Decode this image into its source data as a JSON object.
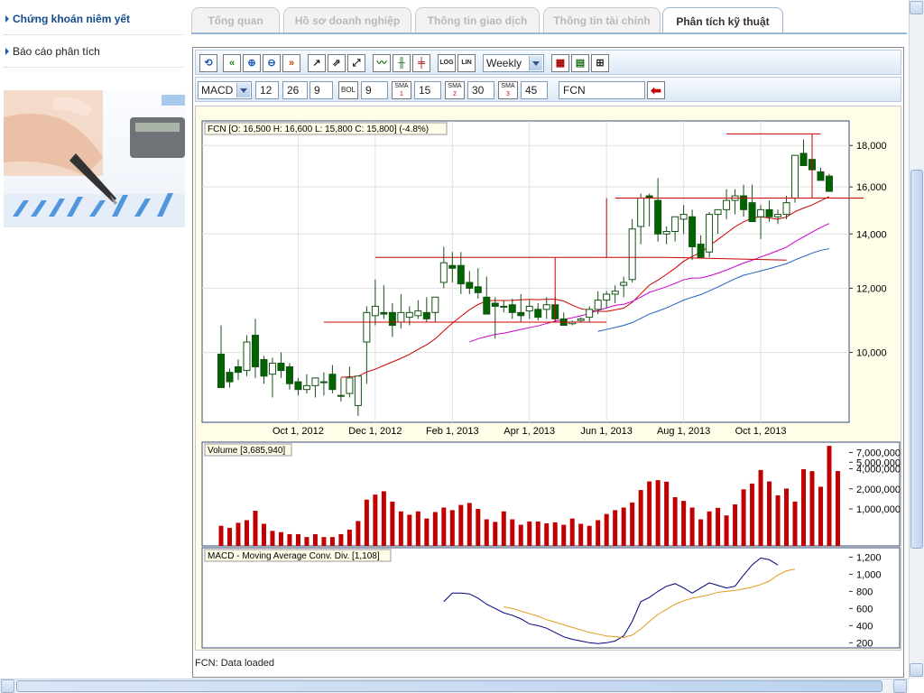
{
  "sidebar": {
    "items": [
      {
        "label": "Chứng khoán niêm yết"
      },
      {
        "label": "Báo cáo phân tích"
      }
    ]
  },
  "tabs": [
    {
      "label": "Tổng quan"
    },
    {
      "label": "Hồ sơ doanh nghiệp"
    },
    {
      "label": "Thông tin giao dịch"
    },
    {
      "label": "Thông tin tài chính"
    },
    {
      "label": "Phân tích kỹ thuật"
    }
  ],
  "toolbar": {
    "scale_log": "LOG",
    "scale_lin": "LIN",
    "period": "Weekly",
    "indicator": "MACD",
    "macd_fast": "12",
    "macd_slow": "26",
    "macd_signal": "9",
    "bol_label": "BOL",
    "bol_value": "9",
    "sma1_label": "SMA",
    "sma1_num": "1",
    "sma1_value": "15",
    "sma2_label": "SMA",
    "sma2_num": "2",
    "sma2_value": "30",
    "sma3_label": "SMA",
    "sma3_num": "3",
    "sma3_value": "45",
    "symbol": "FCN"
  },
  "status": "FCN: Data loaded",
  "colors": {
    "up": "#ffffff",
    "down": "#006400",
    "volume": "#c00000",
    "sma1": "#cc0000",
    "sma2": "#cc00cc",
    "sma3": "#1f5fc4",
    "macd": "#000080",
    "signal": "#e09a1a",
    "trend": "#cc0000"
  },
  "chart_data": [
    {
      "type": "candlestick",
      "title": "FCN [O: 16,500  H: 16,600  L: 15,800  C: 15,800] (-4.8%)",
      "x_tick_labels": [
        "Oct 1, 2012",
        "Dec 1, 2012",
        "Feb 1, 2013",
        "Apr 1, 2013",
        "Jun 1, 2013",
        "Aug 1, 2013",
        "Oct 1, 2013"
      ],
      "y_tick_labels": [
        "10,000",
        "12,000",
        "14,000",
        "16,000",
        "18,000"
      ],
      "scale": "log",
      "ylim": [
        8200,
        19300
      ],
      "ohlc": [
        [
          9950,
          10800,
          9100,
          9050
        ],
        [
          9450,
          9550,
          9050,
          9200
        ],
        [
          9600,
          9800,
          9250,
          9450
        ],
        [
          9500,
          10500,
          9350,
          10300
        ],
        [
          10500,
          11000,
          9300,
          9600
        ],
        [
          9800,
          9900,
          9150,
          9350
        ],
        [
          9400,
          9850,
          8800,
          9700
        ],
        [
          9700,
          10000,
          9300,
          9500
        ],
        [
          9600,
          9700,
          9000,
          9150
        ],
        [
          9200,
          9300,
          8850,
          9000
        ],
        [
          9000,
          9400,
          8900,
          9100
        ],
        [
          9100,
          9250,
          8800,
          9300
        ],
        [
          9200,
          9450,
          8850,
          9200
        ],
        [
          9400,
          9650,
          8900,
          9000
        ],
        [
          8850,
          9300,
          8700,
          8850
        ],
        [
          8900,
          9600,
          8800,
          9300
        ],
        [
          8600,
          9300,
          8350,
          9350
        ],
        [
          10300,
          11400,
          9150,
          11200
        ],
        [
          11100,
          12300,
          10800,
          11400
        ],
        [
          11200,
          12100,
          11000,
          11150
        ],
        [
          11200,
          11500,
          10450,
          10800
        ],
        [
          10900,
          11800,
          10700,
          11200
        ],
        [
          11050,
          11400,
          10800,
          11200
        ],
        [
          11100,
          11600,
          11000,
          11250
        ],
        [
          11200,
          11700,
          10900,
          11000
        ],
        [
          11200,
          11600,
          10900,
          11700
        ],
        [
          12200,
          13500,
          12000,
          12900
        ],
        [
          12800,
          13300,
          12200,
          12700
        ],
        [
          12800,
          13300,
          11800,
          12150
        ],
        [
          12200,
          12600,
          11800,
          12000
        ],
        [
          12050,
          12700,
          11650,
          11850
        ],
        [
          11700,
          12400,
          11300,
          11150
        ],
        [
          11500,
          11700,
          10400,
          11400
        ],
        [
          11400,
          11600,
          11200,
          11400
        ],
        [
          11450,
          11650,
          11000,
          11200
        ],
        [
          11200,
          11800,
          10900,
          11100
        ],
        [
          11250,
          11600,
          11000,
          11400
        ],
        [
          11300,
          11500,
          10950,
          11050
        ],
        [
          11300,
          11700,
          11000,
          11450
        ],
        [
          11450,
          11700,
          10900,
          11000
        ],
        [
          11000,
          11200,
          10900,
          10800
        ],
        [
          10850,
          10950,
          10800,
          10900
        ],
        [
          10950,
          11050,
          10900,
          11000
        ],
        [
          11050,
          11400,
          10900,
          11300
        ],
        [
          11300,
          11900,
          11150,
          11600
        ],
        [
          11600,
          11900,
          11350,
          11800
        ],
        [
          11800,
          12100,
          11500,
          11900
        ],
        [
          12100,
          12400,
          11700,
          12200
        ],
        [
          12300,
          14600,
          12200,
          14200
        ],
        [
          14300,
          15700,
          13600,
          15500
        ],
        [
          15600,
          15700,
          14300,
          15500
        ],
        [
          15400,
          16400,
          13700,
          14000
        ],
        [
          14000,
          14300,
          13600,
          14100
        ],
        [
          14100,
          14500,
          13700,
          14700
        ],
        [
          14600,
          15200,
          14000,
          14800
        ],
        [
          14700,
          15000,
          13000,
          13500
        ],
        [
          13600,
          13950,
          13200,
          13100
        ],
        [
          13300,
          14900,
          13100,
          14800
        ],
        [
          14800,
          15000,
          14000,
          15000
        ],
        [
          15000,
          15900,
          14600,
          15400
        ],
        [
          15400,
          15900,
          14800,
          15600
        ],
        [
          15600,
          16100,
          14700,
          15000
        ],
        [
          15300,
          16100,
          14800,
          14500
        ],
        [
          14700,
          15200,
          13800,
          15000
        ],
        [
          15000,
          15400,
          14500,
          14700
        ],
        [
          14700,
          15000,
          14400,
          14800
        ],
        [
          14800,
          15600,
          14600,
          15300
        ],
        [
          15500,
          15900,
          15300,
          17500
        ],
        [
          17600,
          18300,
          17100,
          17000
        ],
        [
          17300,
          17600,
          16800,
          16800
        ],
        [
          16700,
          16900,
          16400,
          16300
        ],
        [
          16500,
          16600,
          15800,
          15800
        ]
      ],
      "sma": {
        "n": [
          15,
          30,
          45
        ],
        "labels": [
          "SMA 15",
          "SMA 30",
          "SMA 45"
        ]
      }
    },
    {
      "type": "bar",
      "title": "Volume [3,685,940]",
      "y_tick_labels": [
        "1,000,000",
        "2,000,000",
        "4,000,000",
        "5,000,000",
        "7,000,000"
      ],
      "scale": "log",
      "ylim": [
        280000,
        10000000
      ],
      "values": [
        560000,
        520000,
        620000,
        680000,
        940000,
        600000,
        470000,
        450000,
        420000,
        420000,
        380000,
        420000,
        380000,
        380000,
        420000,
        490000,
        660000,
        1380000,
        1640000,
        1840000,
        1290000,
        920000,
        820000,
        920000,
        720000,
        900000,
        1050000,
        960000,
        1150000,
        1230000,
        1000000,
        700000,
        640000,
        920000,
        700000,
        580000,
        650000,
        650000,
        610000,
        630000,
        580000,
        720000,
        600000,
        560000,
        680000,
        840000,
        960000,
        1050000,
        1250000,
        1920000,
        2580000,
        2700000,
        2560000,
        1500000,
        1320000,
        1050000,
        700000,
        920000,
        1040000,
        800000,
        1170000,
        1970000,
        2400000,
        3830000,
        2580000,
        1600000,
        2020000,
        1290000,
        3940000,
        3680000,
        2150000,
        8790000,
        3690000
      ]
    },
    {
      "type": "line",
      "title": "MACD - Moving Average Conv. Div. [1,108]",
      "y_tick_labels": [
        "200",
        "400",
        "600",
        "800",
        "1,000",
        "1,200"
      ],
      "ylim": [
        140,
        1310
      ],
      "start_index": 26,
      "macd": [
        680,
        780,
        780,
        770,
        720,
        650,
        600,
        550,
        520,
        480,
        420,
        400,
        370,
        320,
        270,
        240,
        220,
        200,
        190,
        200,
        220,
        280,
        450,
        680,
        730,
        800,
        860,
        890,
        840,
        780,
        840,
        900,
        870,
        840,
        860,
        990,
        1110,
        1190,
        1170,
        1108
      ],
      "signal_start_index": 33,
      "signal": [
        620,
        600,
        570,
        540,
        510,
        470,
        440,
        410,
        380,
        350,
        320,
        300,
        280,
        270,
        260,
        290,
        360,
        450,
        530,
        590,
        650,
        690,
        720,
        740,
        760,
        790,
        800,
        810,
        830,
        850,
        880,
        920,
        990,
        1040,
        1060
      ]
    }
  ]
}
